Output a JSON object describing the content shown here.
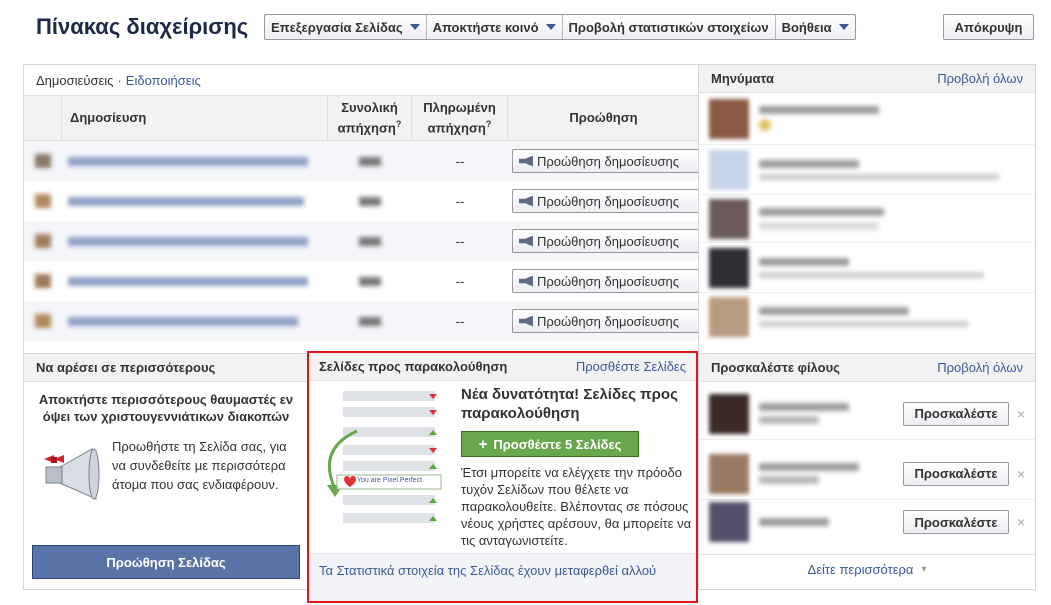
{
  "header": {
    "title": "Πίνακας διαχείρισης",
    "menu": [
      "Επεξεργασία Σελίδας",
      "Αποκτήστε κοινό",
      "Προβολή στατιστικών στοιχείων",
      "Βοήθεια"
    ],
    "hide": "Απόκρυψη"
  },
  "posts": {
    "tab_posts": "Δημοσιεύσεις",
    "sep": "·",
    "tab_notifs": "Ειδοποιήσεις",
    "col_post": "Δημοσίευση",
    "col_total": "Συνολική απήχηση",
    "col_paid": "Πληρωμένη απήχηση",
    "col_promo": "Προώθηση",
    "help": "?",
    "rows": [
      {
        "paid": "--",
        "promo": "Προώθηση δημοσίευσης"
      },
      {
        "paid": "--",
        "promo": "Προώθηση δημοσίευσης"
      },
      {
        "paid": "--",
        "promo": "Προώθηση δημοσίευσης"
      },
      {
        "paid": "--",
        "promo": "Προώθηση δημοσίευσης"
      },
      {
        "paid": "--",
        "promo": "Προώθηση δημοσίευσης"
      }
    ]
  },
  "messages": {
    "title": "Μηνύματα",
    "view_all": "Προβολή όλων"
  },
  "like": {
    "title": "Να αρέσει σε περισσότερους",
    "heading": "Αποκτήστε περισσότερους θαυμαστές εν όψει των χριστουγεννιάτικων διακοπών",
    "body": "Προωθήστε τη Σελίδα σας, για να συνδεθείτε με περισσότερα άτομα που σας ενδιαφέρουν.",
    "button": "Προώθηση Σελίδας"
  },
  "watch": {
    "title": "Σελίδες προς παρακολούθηση",
    "add": "Προσθέστε Σελίδες",
    "heading": "Νέα δυνατότητα! Σελίδες προς παρακολούθηση",
    "button_icon": "+",
    "button": "Προσθέστε 5 Σελίδες",
    "body": "Έτσι μπορείτε να ελέγχετε την πρόοδο τυχόν Σελίδων που θέλετε να παρακολουθείτε. Βλέποντας σε πόσους νέους χρήστες αρέσουν, θα μπορείτε να τις ανταγωνιστείτε.",
    "illus_label": "You are Pixel Perfect",
    "footer": "Τα Στατιστικά στοιχεία της Σελίδας έχουν μεταφερθεί αλλού"
  },
  "invite": {
    "title": "Προσκαλέστε φίλους",
    "view_all": "Προβολή όλων",
    "button": "Προσκαλέστε",
    "close": "×",
    "see_more": "Δείτε περισσότερα",
    "caret": "▾"
  },
  "colors": {
    "accent": "#3b5998",
    "highlight": "#e0161b",
    "green": "#69a74e"
  }
}
